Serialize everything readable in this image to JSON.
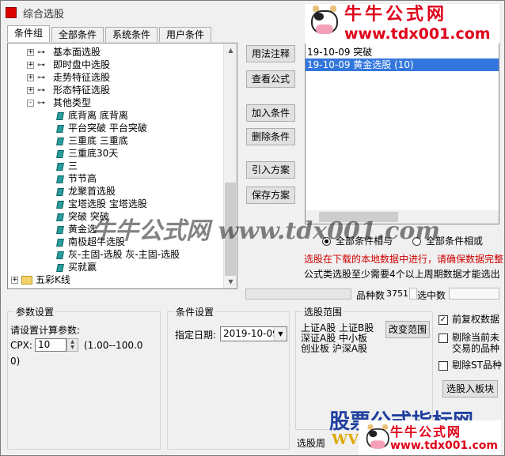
{
  "window": {
    "title": "综合选股"
  },
  "tabs": [
    "条件组",
    "全部条件",
    "系统条件",
    "用户条件"
  ],
  "tree": {
    "items": [
      {
        "type": "group",
        "expander": "+",
        "label": "基本面选股"
      },
      {
        "type": "group",
        "expander": "+",
        "label": "即时盘中选股"
      },
      {
        "type": "group",
        "expander": "+",
        "label": "走势特征选股"
      },
      {
        "type": "group",
        "expander": "+",
        "label": "形态特征选股"
      },
      {
        "type": "group",
        "expander": "-",
        "label": "其他类型"
      },
      {
        "type": "leaf",
        "label": "底背离 底背离"
      },
      {
        "type": "leaf",
        "label": "平台突破 平台突破"
      },
      {
        "type": "leaf",
        "label": "三重底 三重底"
      },
      {
        "type": "leaf",
        "label": "三重底30天"
      },
      {
        "type": "leaf",
        "label": "三"
      },
      {
        "type": "leaf",
        "label": "节节高"
      },
      {
        "type": "leaf",
        "label": "龙聚首选股"
      },
      {
        "type": "leaf",
        "label": "宝塔选股 宝塔选股"
      },
      {
        "type": "leaf",
        "label": "突破 突破"
      },
      {
        "type": "leaf",
        "label": "黄金选"
      },
      {
        "type": "leaf",
        "label": "南极超牛选股"
      },
      {
        "type": "leaf",
        "label": "灰-主固-选股 灰-主固-选股"
      },
      {
        "type": "leaf",
        "label": "买就赢"
      },
      {
        "type": "folder",
        "expander": "+",
        "label": "五彩K线"
      }
    ]
  },
  "buttons": {
    "usage": "用法注释",
    "view_formula": "查看公式",
    "add_condition": "加入条件",
    "delete_condition": "删除条件",
    "import_plan": "引入方案",
    "save_plan": "保存方案",
    "change_range": "改变范围",
    "add_to_block": "选股入板块"
  },
  "condition_list": [
    {
      "text": "19-10-09 突破",
      "selected": false
    },
    {
      "text": "19-10-09 黄金选股 (10)",
      "selected": true
    }
  ],
  "radio": {
    "and_label": "全部条件相与",
    "or_label": "全部条件相或",
    "selected": "and"
  },
  "info": {
    "red_msg": "选股在下载的本地数据中进行，请确保数据完整",
    "black_msg": "公式类选股至少需要4个以上周期数据才能选出"
  },
  "stats": {
    "count_label": "品种数",
    "count_value": "3751",
    "selected_label": "选中数",
    "selected_value": ""
  },
  "params": {
    "legend": "参数设置",
    "prompt": "请设置计算参数:",
    "name": "CPX:",
    "value": "10",
    "range": "(1.00--100.0",
    "range_end": "0)"
  },
  "condition_settings": {
    "legend": "条件设置",
    "date_label": "指定日期:",
    "date_value": "2019-10-09"
  },
  "range": {
    "legend": "选股范围",
    "line1": "上证A股 上证B股",
    "line2": "深证A股 中小板",
    "line3": "创业板 沪深A股"
  },
  "options": {
    "adjust": {
      "label": "前复权数据",
      "checked": true
    },
    "exclude_unlisted": {
      "label1": "剔除当前未",
      "label2": "交易的品种",
      "checked": false
    },
    "exclude_st": {
      "label": "剔除ST品种",
      "checked": false
    }
  },
  "period_label": "选股周",
  "watermarks": {
    "logo_title": "牛牛公式网",
    "logo_url": "www.tdx001.com",
    "center_text": "牛牛公式网 www.tdx001.com",
    "bottom_text": "股票公式指标网",
    "bottom_partial": "WV"
  }
}
